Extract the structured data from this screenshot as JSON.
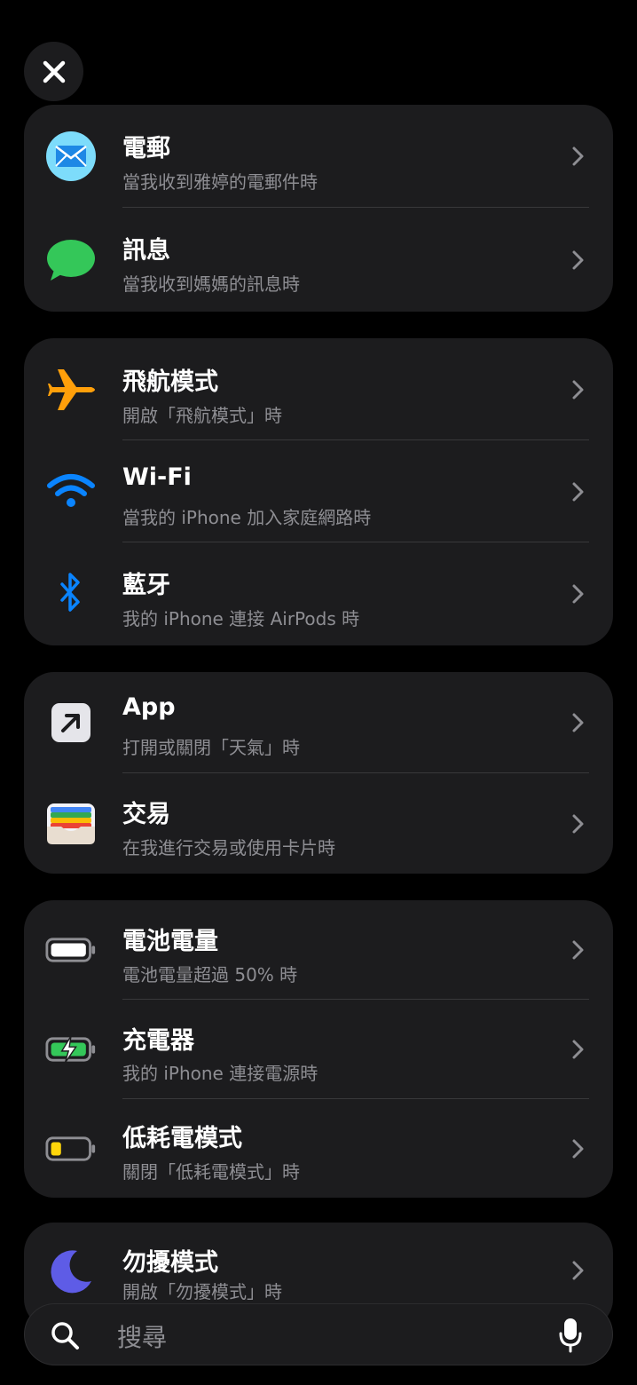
{
  "colors": {
    "background": "#000000",
    "card": "#1c1c1e",
    "secondary_text": "#8e8e93",
    "mail_blue": "#4fc3f7",
    "messages_green": "#34c759",
    "airplane_orange": "#ff9f0a",
    "wifi_blue": "#0a84ff",
    "bluetooth_blue": "#0a84ff",
    "battery_green": "#34c759",
    "low_power_yellow": "#ffd60a",
    "focus_purple": "#5e5ce6"
  },
  "close": {
    "icon": "close-icon"
  },
  "groups": [
    {
      "rows": [
        {
          "icon": "mail-icon",
          "title": "電郵",
          "subtitle": "當我收到雅婷的電郵件時"
        },
        {
          "icon": "messages-icon",
          "title": "訊息",
          "subtitle": "當我收到媽媽的訊息時"
        }
      ]
    },
    {
      "rows": [
        {
          "icon": "airplane-icon",
          "title": "飛航模式",
          "subtitle": "開啟「飛航模式」時"
        },
        {
          "icon": "wifi-icon",
          "title": "Wi-Fi",
          "subtitle": "當我的 iPhone 加入家庭網路時"
        },
        {
          "icon": "bluetooth-icon",
          "title": "藍牙",
          "subtitle": "我的 iPhone 連接 AirPods 時"
        }
      ]
    },
    {
      "rows": [
        {
          "icon": "app-arrow-icon",
          "title": "App",
          "subtitle": "打開或關閉「天氣」時"
        },
        {
          "icon": "wallet-icon",
          "title": "交易",
          "subtitle": "在我進行交易或使用卡片時"
        }
      ]
    },
    {
      "rows": [
        {
          "icon": "battery-full-icon",
          "title": "電池電量",
          "subtitle": "電池電量超過 50% 時"
        },
        {
          "icon": "battery-charging-icon",
          "title": "充電器",
          "subtitle": "我的 iPhone 連接電源時"
        },
        {
          "icon": "battery-low-icon",
          "title": "低耗電模式",
          "subtitle": "關閉「低耗電模式」時"
        }
      ]
    },
    {
      "rows": [
        {
          "icon": "moon-icon",
          "title": "勿擾模式",
          "subtitle": "開啟「勿擾模式」時"
        }
      ]
    }
  ],
  "search": {
    "placeholder": "搜尋",
    "icon": "search-icon",
    "mic_icon": "microphone-icon"
  }
}
